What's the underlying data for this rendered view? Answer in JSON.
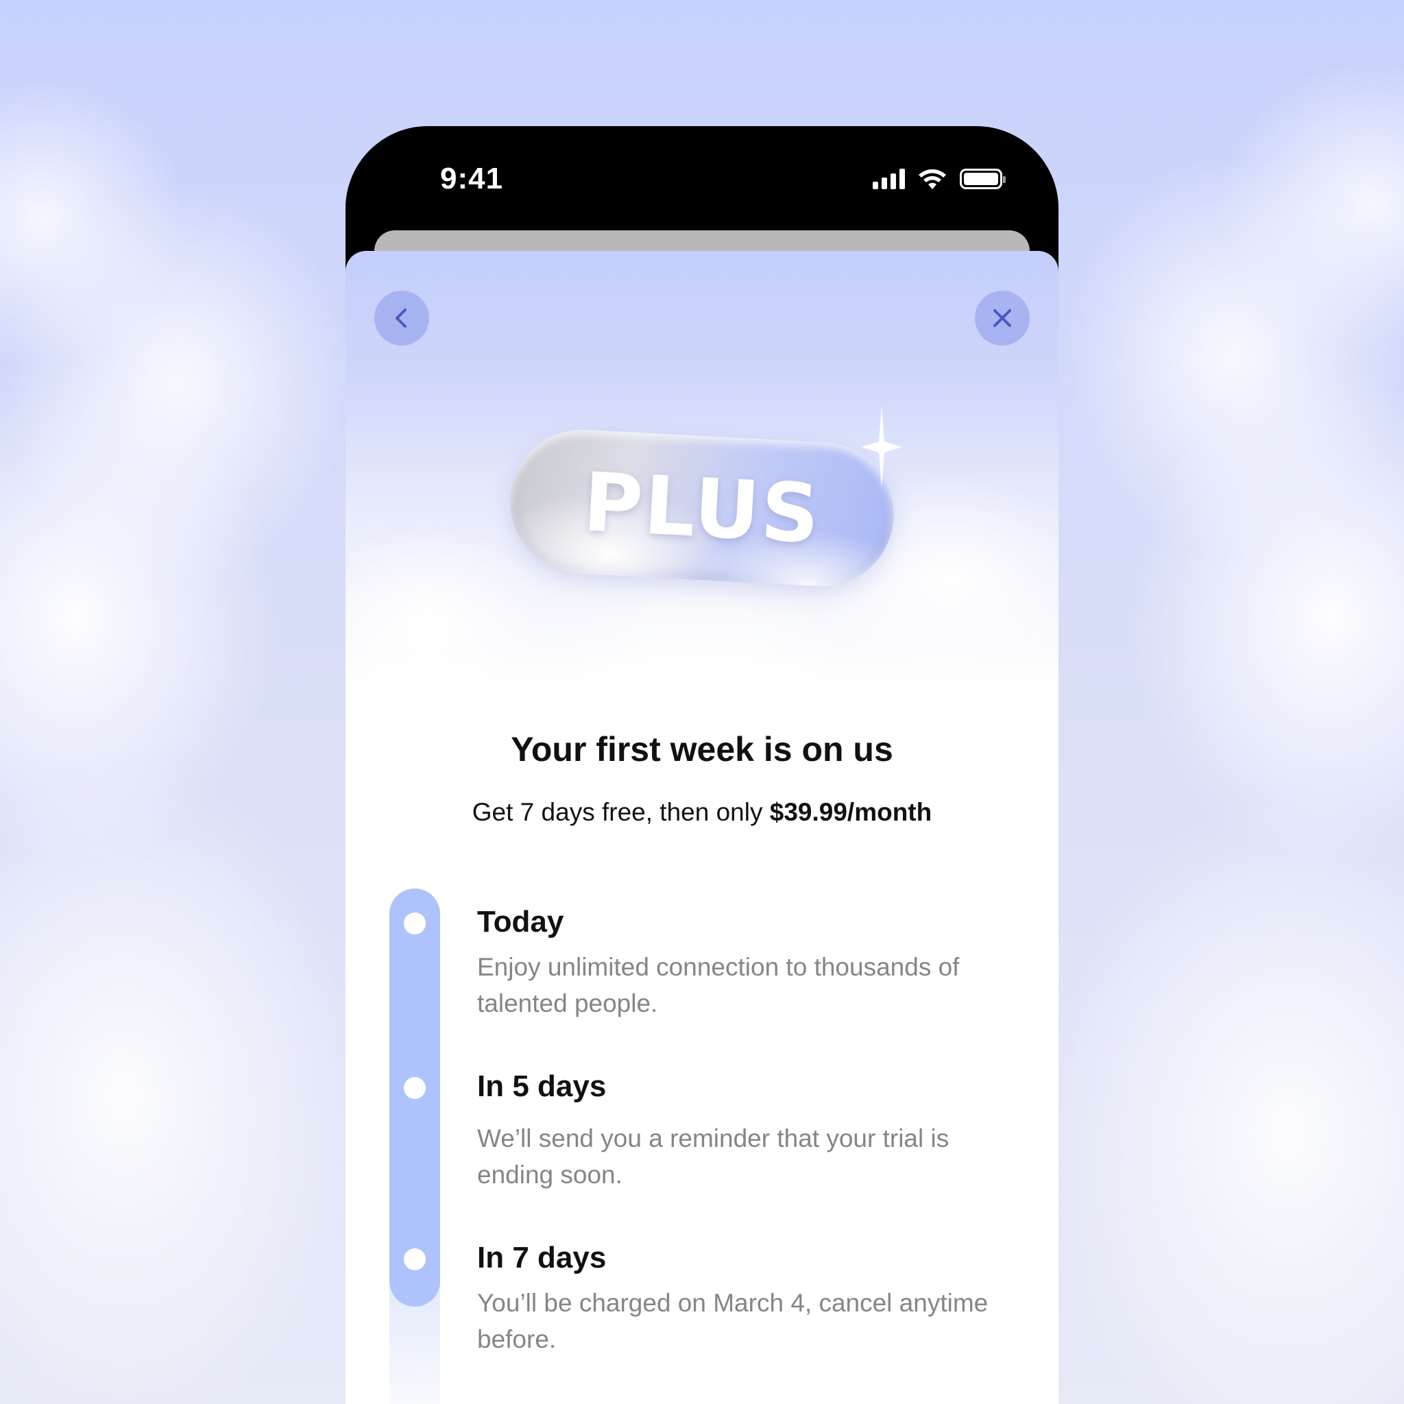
{
  "status_bar": {
    "time": "9:41",
    "icons": [
      "signal-icon",
      "wifi-icon",
      "battery-icon"
    ]
  },
  "header": {
    "back_icon": "chevron-left-icon",
    "close_icon": "close-icon"
  },
  "badge": {
    "text": "PLUS"
  },
  "offer": {
    "title": "Your first week is on us",
    "subtitle_prefix": "Get 7 days free, then only ",
    "price": "$39.99/month"
  },
  "timeline": [
    {
      "title": "Today",
      "description": "Enjoy unlimited connection to thousands of talented people."
    },
    {
      "title": "In 5 days",
      "description": "We’ll send you a reminder that your trial is ending soon."
    },
    {
      "title": "In 7 days",
      "description": "You’ll be charged on March 4, cancel anytime before."
    }
  ],
  "colors": {
    "accent": "#aec3fb",
    "button_bg": "#a8b3f2",
    "icon_color": "#4a58c4",
    "background": "#c8d1fd"
  }
}
